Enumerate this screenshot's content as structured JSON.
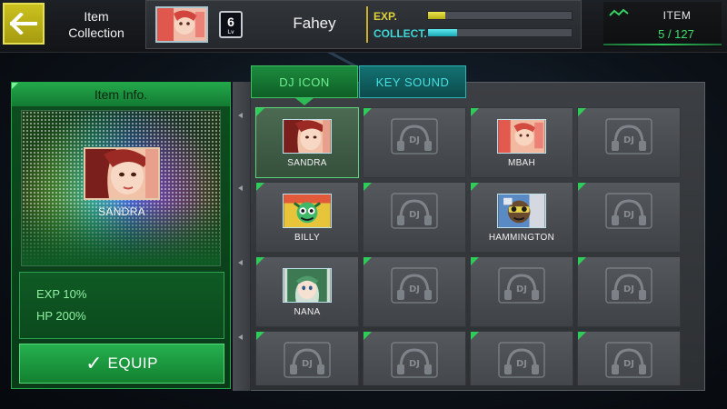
{
  "header": {
    "back_icon": "arrow-left-icon",
    "title": "Item\nCollection",
    "player": {
      "name": "Fahey",
      "level": "6",
      "level_suffix": "Lv",
      "exp_label": "EXP.",
      "exp_progress": 0.12,
      "collect_label": "COLLECT.",
      "collect_progress": 0.2
    },
    "item_counter": {
      "icon": "trend-line-icon",
      "label": "ITEM",
      "count": "5 / 127"
    }
  },
  "info_panel": {
    "title": "Item Info.",
    "selected_name": "SANDRA",
    "stats": [
      "EXP 10%",
      "HP 200%"
    ],
    "equip_label": "EQUIP",
    "equip_icon": "checkmark-icon"
  },
  "tabs": [
    {
      "label": "DJ ICON",
      "active": true
    },
    {
      "label": "KEY SOUND",
      "active": false
    }
  ],
  "grid": {
    "locked_label": "DJ",
    "locked_icon": "headphones-dj-icon",
    "items": [
      {
        "name": "SANDRA",
        "unlocked": true,
        "selected": true,
        "art": "sandra"
      },
      {
        "name": "",
        "unlocked": false
      },
      {
        "name": "MBAH",
        "unlocked": true,
        "art": "mbah"
      },
      {
        "name": "",
        "unlocked": false
      },
      {
        "name": "BILLY",
        "unlocked": true,
        "art": "billy"
      },
      {
        "name": "",
        "unlocked": false
      },
      {
        "name": "HAMMINGTON",
        "unlocked": true,
        "art": "hammington"
      },
      {
        "name": "",
        "unlocked": false
      },
      {
        "name": "NANA",
        "unlocked": true,
        "art": "nana"
      },
      {
        "name": "",
        "unlocked": false
      },
      {
        "name": "",
        "unlocked": false
      },
      {
        "name": "",
        "unlocked": false
      },
      {
        "name": "",
        "unlocked": false
      },
      {
        "name": "",
        "unlocked": false
      },
      {
        "name": "",
        "unlocked": false
      },
      {
        "name": "",
        "unlocked": false
      }
    ]
  },
  "colors": {
    "accent_green": "#2fcc5a",
    "exp_yellow": "#e0d23a",
    "collect_cyan": "#3fd6d8",
    "back_button": "#cbc21f"
  }
}
